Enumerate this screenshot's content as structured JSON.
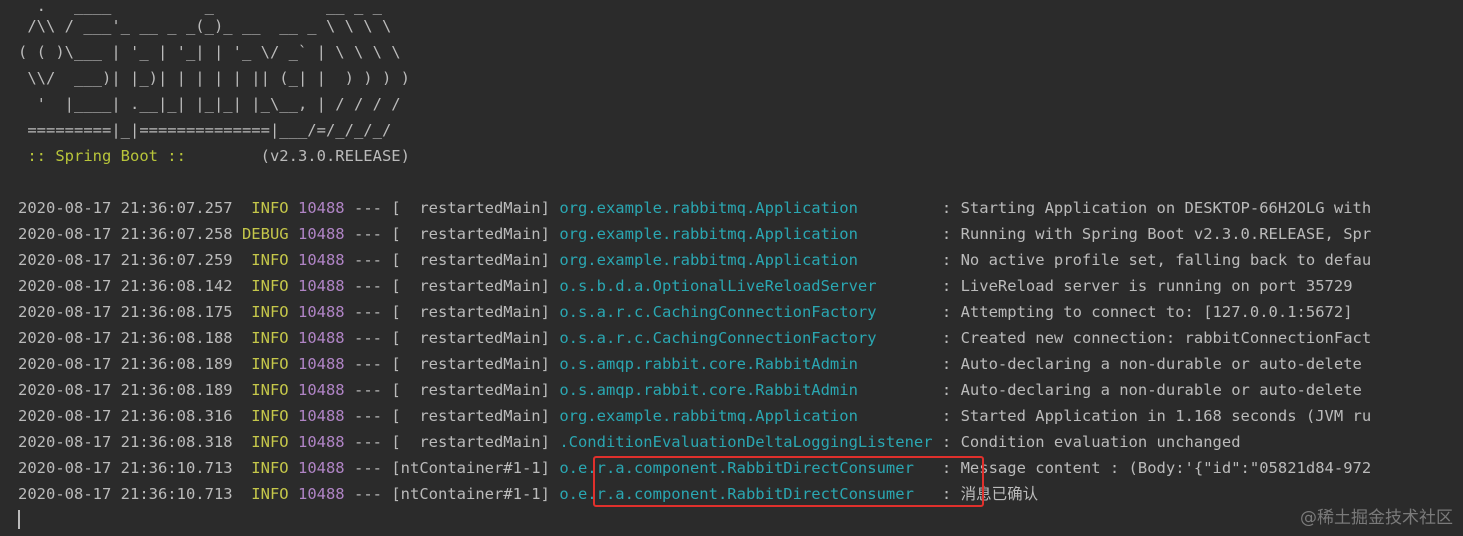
{
  "colors": {
    "background": "#2b2b2b",
    "default_text": "#bbbbbb",
    "level_text": "#c5c74a",
    "pid_text": "#b084c5",
    "logger_text": "#2aa7b2",
    "spring_boot_text": "#b8c53a",
    "highlight_border": "#e0302c"
  },
  "banner": {
    "lines": [
      "  .   ____          _            __ _ _",
      " /\\\\ / ___'_ __ _ _(_)_ __  __ _ \\ \\ \\ \\",
      "( ( )\\___ | '_ | '_| | '_ \\/ _` | \\ \\ \\ \\",
      " \\\\/  ___)| |_)| | | | | || (_| |  ) ) ) )",
      "  '  |____| .__|_| |_|_| |_\\__, | / / / /",
      " =========|_|==============|___/=/_/_/_/"
    ],
    "spring_label": " :: Spring Boot :: ",
    "version": "       (v2.3.0.RELEASE)"
  },
  "log_lines": [
    {
      "timestamp": "2020-08-17 21:36:07.257",
      "level": "  INFO",
      "pid": "10488",
      "sep": " --- ",
      "thread": "[  restartedMain]",
      "logger": "org.example.rabbitmq.Application        ",
      "message": " : Starting Application on DESKTOP-66H2OLG with"
    },
    {
      "timestamp": "2020-08-17 21:36:07.258",
      "level": " DEBUG",
      "pid": "10488",
      "sep": " --- ",
      "thread": "[  restartedMain]",
      "logger": "org.example.rabbitmq.Application        ",
      "message": " : Running with Spring Boot v2.3.0.RELEASE, Spr"
    },
    {
      "timestamp": "2020-08-17 21:36:07.259",
      "level": "  INFO",
      "pid": "10488",
      "sep": " --- ",
      "thread": "[  restartedMain]",
      "logger": "org.example.rabbitmq.Application        ",
      "message": " : No active profile set, falling back to defau"
    },
    {
      "timestamp": "2020-08-17 21:36:08.142",
      "level": "  INFO",
      "pid": "10488",
      "sep": " --- ",
      "thread": "[  restartedMain]",
      "logger": "o.s.b.d.a.OptionalLiveReloadServer      ",
      "message": " : LiveReload server is running on port 35729"
    },
    {
      "timestamp": "2020-08-17 21:36:08.175",
      "level": "  INFO",
      "pid": "10488",
      "sep": " --- ",
      "thread": "[  restartedMain]",
      "logger": "o.s.a.r.c.CachingConnectionFactory      ",
      "message": " : Attempting to connect to: [127.0.0.1:5672]"
    },
    {
      "timestamp": "2020-08-17 21:36:08.188",
      "level": "  INFO",
      "pid": "10488",
      "sep": " --- ",
      "thread": "[  restartedMain]",
      "logger": "o.s.a.r.c.CachingConnectionFactory      ",
      "message": " : Created new connection: rabbitConnectionFact"
    },
    {
      "timestamp": "2020-08-17 21:36:08.189",
      "level": "  INFO",
      "pid": "10488",
      "sep": " --- ",
      "thread": "[  restartedMain]",
      "logger": "o.s.amqp.rabbit.core.RabbitAdmin        ",
      "message": " : Auto-declaring a non-durable or auto-delete"
    },
    {
      "timestamp": "2020-08-17 21:36:08.189",
      "level": "  INFO",
      "pid": "10488",
      "sep": " --- ",
      "thread": "[  restartedMain]",
      "logger": "o.s.amqp.rabbit.core.RabbitAdmin        ",
      "message": " : Auto-declaring a non-durable or auto-delete"
    },
    {
      "timestamp": "2020-08-17 21:36:08.316",
      "level": "  INFO",
      "pid": "10488",
      "sep": " --- ",
      "thread": "[  restartedMain]",
      "logger": "org.example.rabbitmq.Application        ",
      "message": " : Started Application in 1.168 seconds (JVM ru"
    },
    {
      "timestamp": "2020-08-17 21:36:08.318",
      "level": "  INFO",
      "pid": "10488",
      "sep": " --- ",
      "thread": "[  restartedMain]",
      "logger": ".ConditionEvaluationDeltaLoggingListener",
      "message": " : Condition evaluation unchanged"
    },
    {
      "timestamp": "2020-08-17 21:36:10.713",
      "level": "  INFO",
      "pid": "10488",
      "sep": " --- ",
      "thread": "[ntContainer#1-1]",
      "logger": "o.e.r.a.component.RabbitDirectConsumer  ",
      "message": " : Message content : (Body:'{\"id\":\"05821d84-972"
    },
    {
      "timestamp": "2020-08-17 21:36:10.713",
      "level": "  INFO",
      "pid": "10488",
      "sep": " --- ",
      "thread": "[ntContainer#1-1]",
      "logger": "o.e.r.a.component.RabbitDirectConsumer  ",
      "message": " : 消息已确认"
    }
  ],
  "watermark": "@稀土掘金技术社区"
}
